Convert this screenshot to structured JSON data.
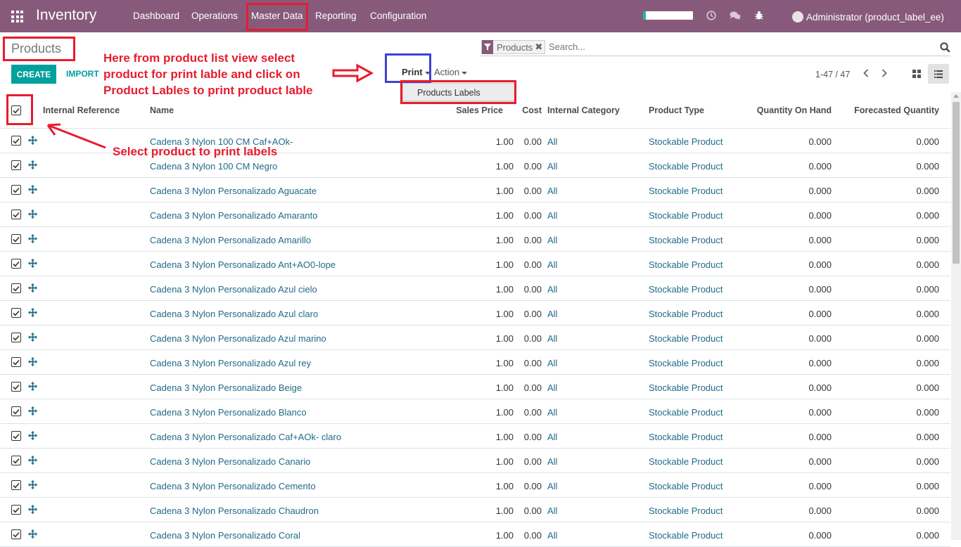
{
  "navbar": {
    "brand": "Inventory",
    "menu": [
      "Dashboard",
      "Operations",
      "Master Data",
      "Reporting",
      "Configuration"
    ],
    "progress_fraction": 0.06,
    "user": "Administrator (product_label_ee)"
  },
  "control_panel": {
    "breadcrumb": "Products",
    "search": {
      "facet": "Products",
      "placeholder": "Search..."
    },
    "create_label": "CREATE",
    "import_label": "IMPORT",
    "print_label": "Print",
    "action_label": "Action",
    "print_menu_item": "Products Labels",
    "pager": "1-47 / 47"
  },
  "table": {
    "headers": {
      "internal_reference": "Internal Reference",
      "name": "Name",
      "sales_price": "Sales Price",
      "cost": "Cost",
      "internal_category": "Internal Category",
      "product_type": "Product Type",
      "qty_on_hand": "Quantity On Hand",
      "forecasted_qty": "Forecasted Quantity"
    },
    "rows": [
      {
        "name": "Cadena 3 Nylon 100 CM Caf+AOk-",
        "price": "1.00",
        "cost": "0.00",
        "category": "All",
        "type": "Stockable Product",
        "on_hand": "0.000",
        "forecast": "0.000"
      },
      {
        "name": "Cadena 3 Nylon 100 CM Negro",
        "price": "1.00",
        "cost": "0.00",
        "category": "All",
        "type": "Stockable Product",
        "on_hand": "0.000",
        "forecast": "0.000"
      },
      {
        "name": "Cadena 3 Nylon Personalizado Aguacate",
        "price": "1.00",
        "cost": "0.00",
        "category": "All",
        "type": "Stockable Product",
        "on_hand": "0.000",
        "forecast": "0.000"
      },
      {
        "name": "Cadena 3 Nylon Personalizado Amaranto",
        "price": "1.00",
        "cost": "0.00",
        "category": "All",
        "type": "Stockable Product",
        "on_hand": "0.000",
        "forecast": "0.000"
      },
      {
        "name": "Cadena 3 Nylon Personalizado Amarillo",
        "price": "1.00",
        "cost": "0.00",
        "category": "All",
        "type": "Stockable Product",
        "on_hand": "0.000",
        "forecast": "0.000"
      },
      {
        "name": "Cadena 3 Nylon Personalizado Ant+AO0-lope",
        "price": "1.00",
        "cost": "0.00",
        "category": "All",
        "type": "Stockable Product",
        "on_hand": "0.000",
        "forecast": "0.000"
      },
      {
        "name": "Cadena 3 Nylon Personalizado Azul cielo",
        "price": "1.00",
        "cost": "0.00",
        "category": "All",
        "type": "Stockable Product",
        "on_hand": "0.000",
        "forecast": "0.000"
      },
      {
        "name": "Cadena 3 Nylon Personalizado Azul claro",
        "price": "1.00",
        "cost": "0.00",
        "category": "All",
        "type": "Stockable Product",
        "on_hand": "0.000",
        "forecast": "0.000"
      },
      {
        "name": "Cadena 3 Nylon Personalizado Azul marino",
        "price": "1.00",
        "cost": "0.00",
        "category": "All",
        "type": "Stockable Product",
        "on_hand": "0.000",
        "forecast": "0.000"
      },
      {
        "name": "Cadena 3 Nylon Personalizado Azul rey",
        "price": "1.00",
        "cost": "0.00",
        "category": "All",
        "type": "Stockable Product",
        "on_hand": "0.000",
        "forecast": "0.000"
      },
      {
        "name": "Cadena 3 Nylon Personalizado Beige",
        "price": "1.00",
        "cost": "0.00",
        "category": "All",
        "type": "Stockable Product",
        "on_hand": "0.000",
        "forecast": "0.000"
      },
      {
        "name": "Cadena 3 Nylon Personalizado Blanco",
        "price": "1.00",
        "cost": "0.00",
        "category": "All",
        "type": "Stockable Product",
        "on_hand": "0.000",
        "forecast": "0.000"
      },
      {
        "name": "Cadena 3 Nylon Personalizado Caf+AOk- claro",
        "price": "1.00",
        "cost": "0.00",
        "category": "All",
        "type": "Stockable Product",
        "on_hand": "0.000",
        "forecast": "0.000"
      },
      {
        "name": "Cadena 3 Nylon Personalizado Canario",
        "price": "1.00",
        "cost": "0.00",
        "category": "All",
        "type": "Stockable Product",
        "on_hand": "0.000",
        "forecast": "0.000"
      },
      {
        "name": "Cadena 3 Nylon Personalizado Cemento",
        "price": "1.00",
        "cost": "0.00",
        "category": "All",
        "type": "Stockable Product",
        "on_hand": "0.000",
        "forecast": "0.000"
      },
      {
        "name": "Cadena 3 Nylon Personalizado Chaudron",
        "price": "1.00",
        "cost": "0.00",
        "category": "All",
        "type": "Stockable Product",
        "on_hand": "0.000",
        "forecast": "0.000"
      },
      {
        "name": "Cadena 3 Nylon Personalizado Coral",
        "price": "1.00",
        "cost": "0.00",
        "category": "All",
        "type": "Stockable Product",
        "on_hand": "0.000",
        "forecast": "0.000"
      }
    ]
  },
  "annotations": {
    "print_instruction": [
      "Here from product list view select",
      "product  for print lable and click on",
      "Product Lables to print product lable"
    ],
    "select_instruction": "Select product to print labels",
    "color": "#e81c2e",
    "highlight_color": "#3d42d6"
  },
  "icons": {
    "apps": "apps-grid-icon",
    "activity": "clock-icon",
    "messaging": "chat-bubbles-icon",
    "debug": "bug-icon",
    "search": "magnifier-icon",
    "filter": "funnel-icon",
    "kanban": "kanban-view-icon",
    "list": "list-view-icon",
    "drag": "move-arrows-icon"
  }
}
